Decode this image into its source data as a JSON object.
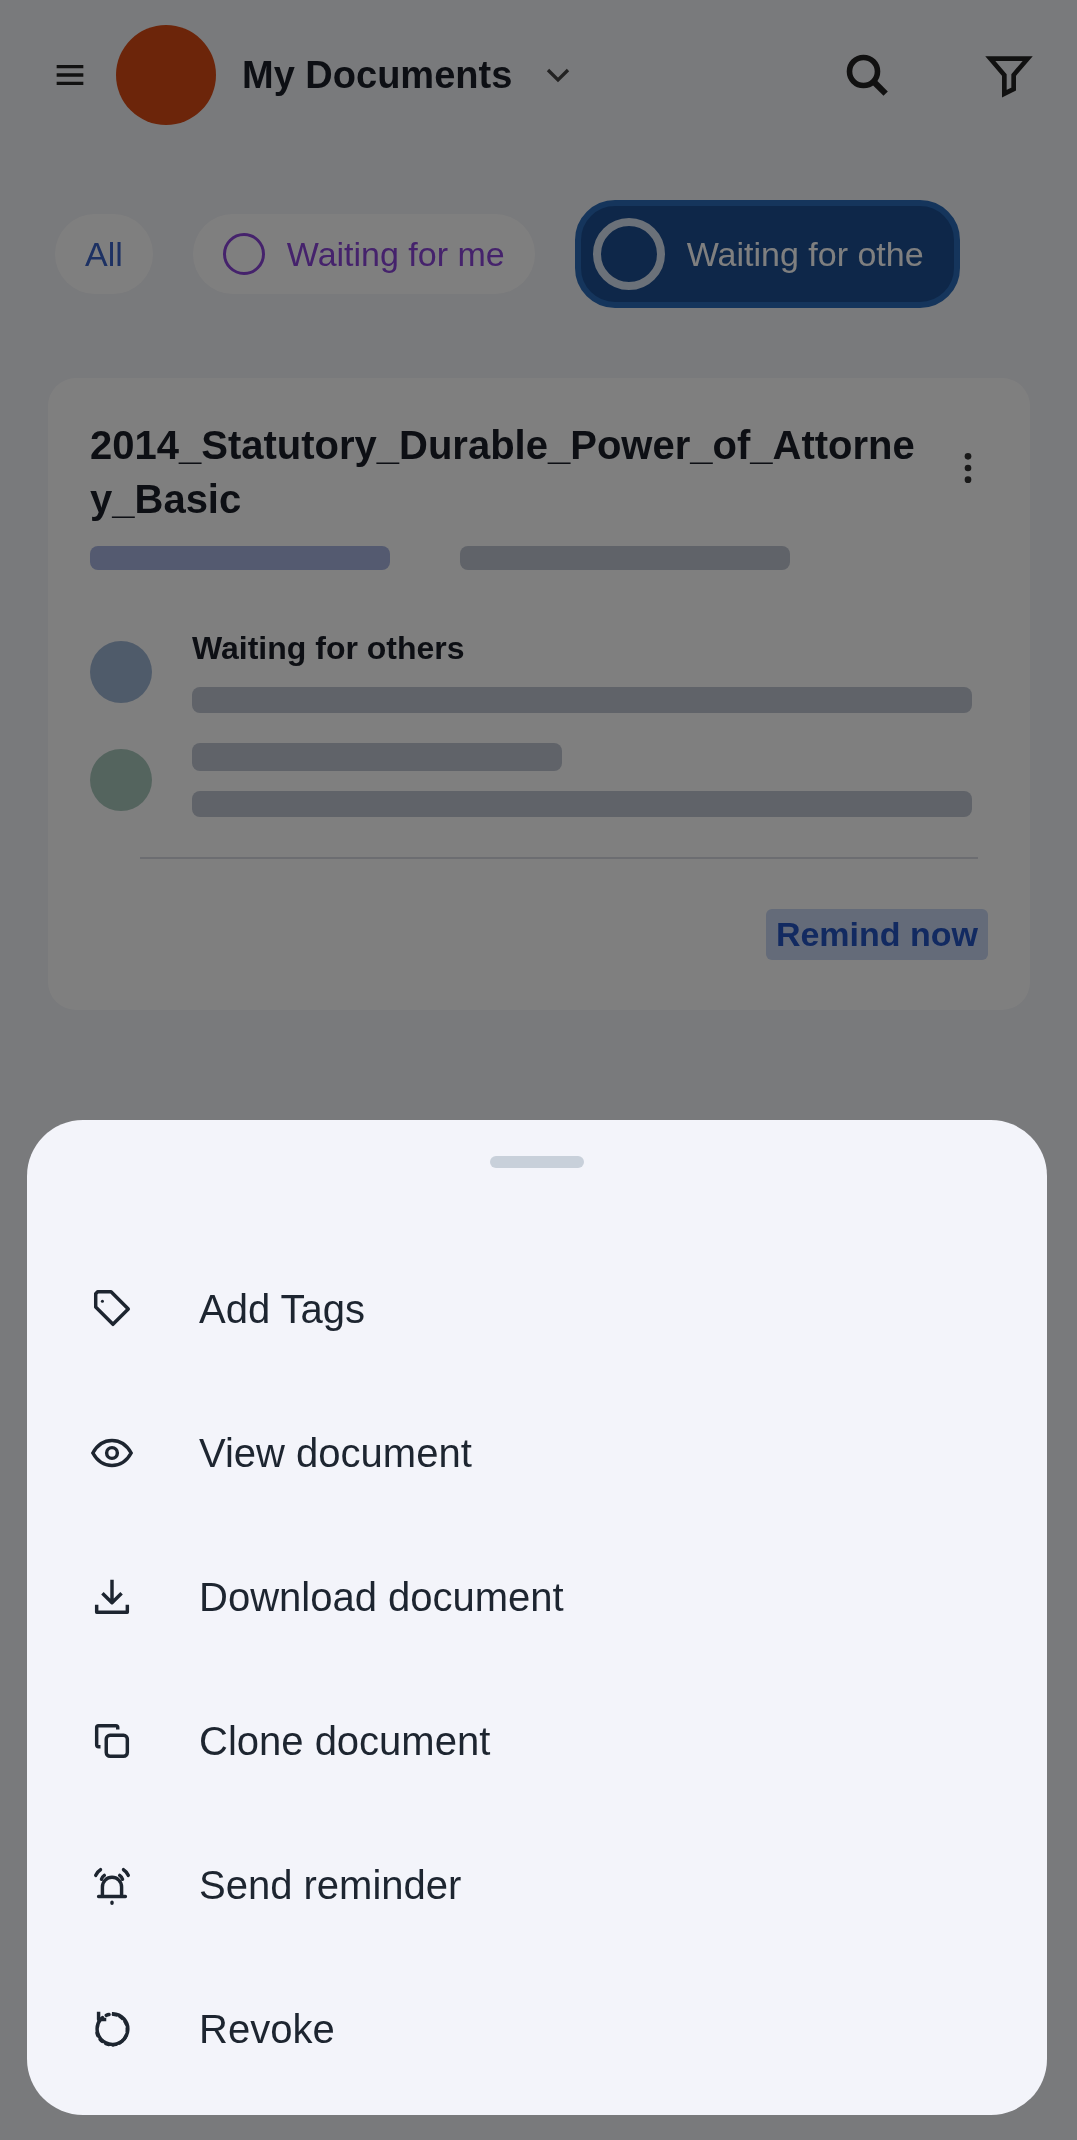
{
  "header": {
    "title": "My Documents"
  },
  "filters": [
    {
      "label": "All",
      "selected": false
    },
    {
      "label": "Waiting for me",
      "selected": false
    },
    {
      "label": "Waiting for othe",
      "selected": true
    }
  ],
  "card": {
    "title": "2014_Statutory_Durable_Power_of_Attorney_Basic",
    "history": [
      {
        "kind": "pending",
        "title": "Waiting for others"
      },
      {
        "kind": "signed"
      }
    ],
    "action": "Remind now"
  },
  "sheet": {
    "items": [
      {
        "kind": "tag",
        "label": "Add Tags"
      },
      {
        "kind": "view",
        "label": "View document"
      },
      {
        "kind": "download",
        "label": "Download document"
      },
      {
        "kind": "clone",
        "label": "Clone document"
      },
      {
        "kind": "remind",
        "label": "Send reminder"
      },
      {
        "kind": "revoke",
        "label": "Revoke"
      }
    ]
  }
}
